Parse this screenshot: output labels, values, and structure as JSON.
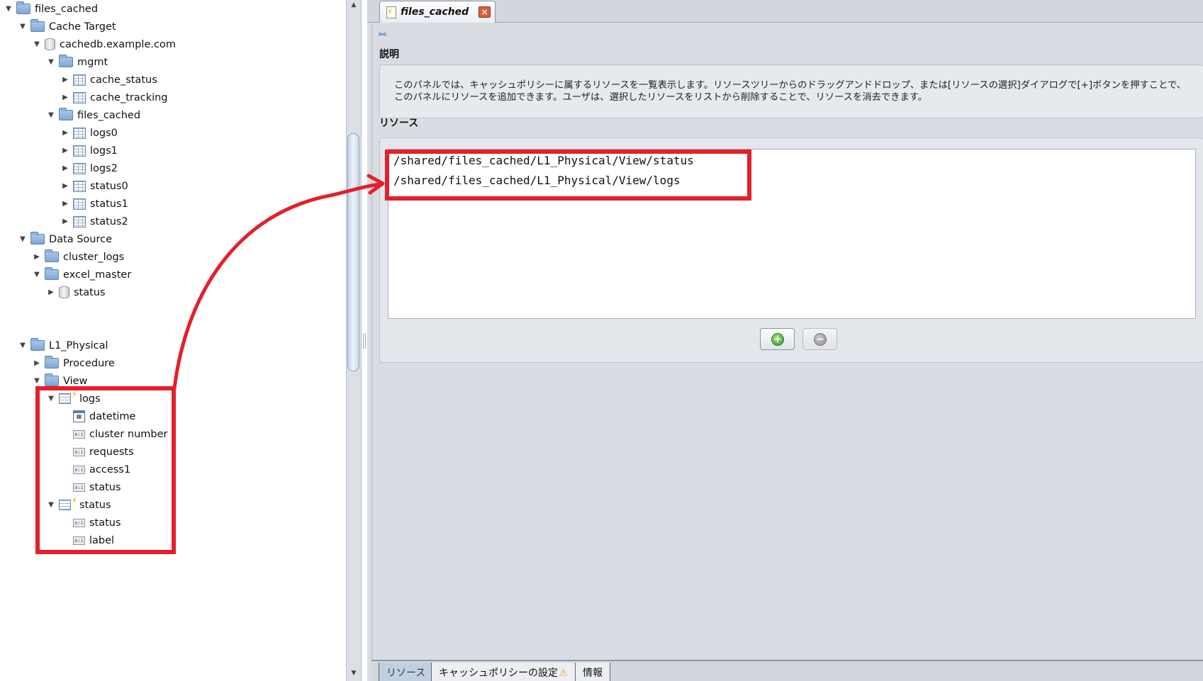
{
  "tree": {
    "nodes": [
      {
        "label": "files_cached",
        "icon": "folder-icon",
        "toggle": "expanded"
      },
      {
        "label": "Cache Target",
        "icon": "folder-icon",
        "toggle": "expanded"
      },
      {
        "label": "cachedb.example.com",
        "icon": "database-icon",
        "toggle": "expanded"
      },
      {
        "label": "mgmt",
        "icon": "folder-icon",
        "toggle": "expanded"
      },
      {
        "label": "cache_status",
        "icon": "table-icon",
        "toggle": "collapsed"
      },
      {
        "label": "cache_tracking",
        "icon": "table-icon",
        "toggle": "collapsed"
      },
      {
        "label": "files_cached",
        "icon": "folder-icon",
        "toggle": "expanded"
      },
      {
        "label": "logs0",
        "icon": "table-icon",
        "toggle": "collapsed"
      },
      {
        "label": "logs1",
        "icon": "table-icon",
        "toggle": "collapsed"
      },
      {
        "label": "logs2",
        "icon": "table-icon",
        "toggle": "collapsed"
      },
      {
        "label": "status0",
        "icon": "table-icon",
        "toggle": "collapsed"
      },
      {
        "label": "status1",
        "icon": "table-icon",
        "toggle": "collapsed"
      },
      {
        "label": "status2",
        "icon": "table-icon",
        "toggle": "collapsed"
      },
      {
        "label": "Data Source",
        "icon": "folder-icon",
        "toggle": "expanded"
      },
      {
        "label": "cluster_logs",
        "icon": "folder-icon",
        "toggle": "collapsed"
      },
      {
        "label": "excel_master",
        "icon": "folder-icon",
        "toggle": "expanded"
      },
      {
        "label": "status",
        "icon": "database-icon",
        "toggle": "collapsed"
      },
      {
        "label": "L1_Physical",
        "icon": "folder-icon",
        "toggle": "expanded"
      },
      {
        "label": "Procedure",
        "icon": "folder-icon",
        "toggle": "collapsed"
      },
      {
        "label": "View",
        "icon": "folder-icon",
        "toggle": "expanded"
      },
      {
        "label": "logs",
        "icon": "view-icon",
        "toggle": "expanded"
      },
      {
        "label": "datetime",
        "icon": "calendar-column-icon",
        "toggle": "none"
      },
      {
        "label": "cluster number",
        "icon": "column-icon",
        "toggle": "none"
      },
      {
        "label": "requests",
        "icon": "column-icon",
        "toggle": "none"
      },
      {
        "label": "access1",
        "icon": "column-icon",
        "toggle": "none"
      },
      {
        "label": "status",
        "icon": "column-icon",
        "toggle": "none"
      },
      {
        "label": "status",
        "icon": "view-icon",
        "toggle": "expanded"
      },
      {
        "label": "status",
        "icon": "column-icon",
        "toggle": "none"
      },
      {
        "label": "label",
        "icon": "column-icon",
        "toggle": "none"
      }
    ]
  },
  "editor": {
    "tab_label": "files_cached",
    "tab_icon": "document-icon",
    "close_icon": "close-icon",
    "toolbar_icon": "tree-structure-icon",
    "description_heading": "説明",
    "description_text": "このパネルでは、キャッシュポリシーに属するリソースを一覧表示します。リソースツリーからのドラッグアンドドロップ、または[リソースの選択]ダイアログで[+]ボタンを押すことで、このパネルにリソースを追加できます。ユーザは、選択したリソースをリストから削除することで、リソースを消去できます。",
    "resources_heading": "リソース",
    "resources": [
      "/shared/files_cached/L1_Physical/View/status",
      "/shared/files_cached/L1_Physical/View/logs"
    ],
    "add_icon": "add-icon",
    "remove_icon": "remove-icon"
  },
  "bottom_tabs": [
    {
      "label": "リソース",
      "active": true
    },
    {
      "label": "キャッシュポリシーの設定",
      "warning_icon": "warning-icon",
      "active": false
    },
    {
      "label": "情報",
      "active": false
    }
  ],
  "colors": {
    "annotation_red": "#e3202b",
    "panel_bg": "#d9dde3",
    "active_tab": "#c2cfe0"
  }
}
